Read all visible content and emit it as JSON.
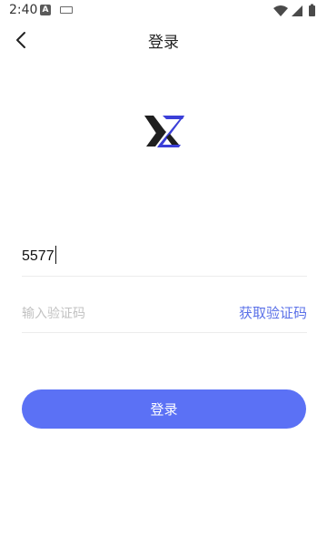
{
  "status_bar": {
    "time": "2:40",
    "notification_icon_letter": "A",
    "icons": [
      "notification-a-icon",
      "keyboard-icon",
      "wifi-icon",
      "signal-icon",
      "battery-icon"
    ]
  },
  "nav": {
    "title": "登录",
    "back_icon": "chevron-left-icon"
  },
  "logo": {
    "icon": "yz-logo-icon",
    "colors": {
      "dark": "#1f1f1f",
      "accent": "#3b3fd8"
    }
  },
  "form": {
    "phone_value": "5577",
    "code_placeholder": "输入验证码",
    "get_code_label": "获取验证码"
  },
  "login_button": {
    "label": "登录"
  },
  "colors": {
    "accent": "#5b71f5",
    "link": "#5a70e8",
    "placeholder": "#c2c2c2",
    "divider": "#ececec"
  }
}
